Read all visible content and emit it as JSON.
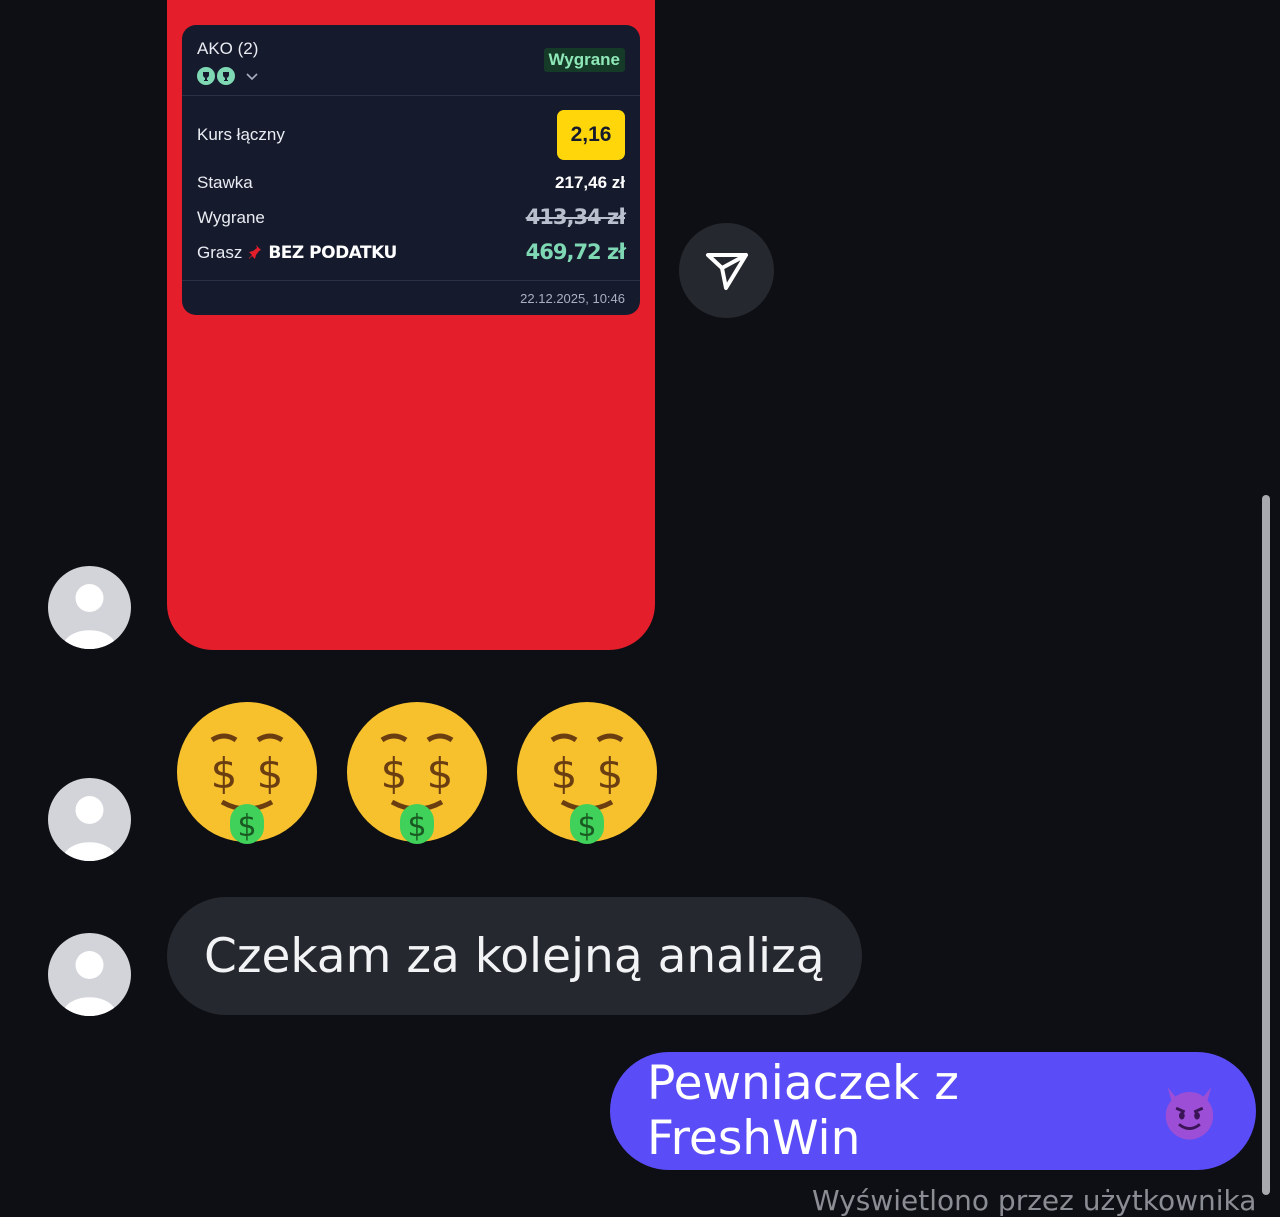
{
  "bet_card": {
    "title": "AKO (2)",
    "status_badge": "Wygrane",
    "total_odds_label": "Kurs łączny",
    "total_odds_value": "2,16",
    "stake_label": "Stawka",
    "stake_value": "217,46 zł",
    "winnings_label": "Wygrane",
    "winnings_value_old": "413,34 zł",
    "play_label": "Grasz",
    "no_tax_label": "BEZ PODATKU",
    "winnings_value_new": "469,72 zł",
    "timestamp": "22.12.2025, 10:46",
    "colors": {
      "card_bg": "#e41e2b",
      "ticket_bg": "#151a2c",
      "odds_bg": "#ffd60a",
      "win_green": "#7fd8b4"
    },
    "icons": [
      "trophy-icon",
      "trophy-icon",
      "chevron-down-icon"
    ]
  },
  "share_button": {
    "icon": "send-icon"
  },
  "messages": [
    {
      "type": "emoji",
      "content": "🤑🤑🤑",
      "icon": "money-mouth-face-emoji"
    },
    {
      "type": "text",
      "text": "Czekam za kolejną analizą"
    },
    {
      "type": "text",
      "direction": "outgoing",
      "text": "Pewniaczek z FreshWin",
      "icon": "smiling-devil-emoji"
    }
  ],
  "seen_text": "Wyświetlono przez użytkownika",
  "colors": {
    "background": "#0e0f14",
    "incoming_bubble": "#26282f",
    "outgoing_bubble": "#5a4cf6"
  }
}
